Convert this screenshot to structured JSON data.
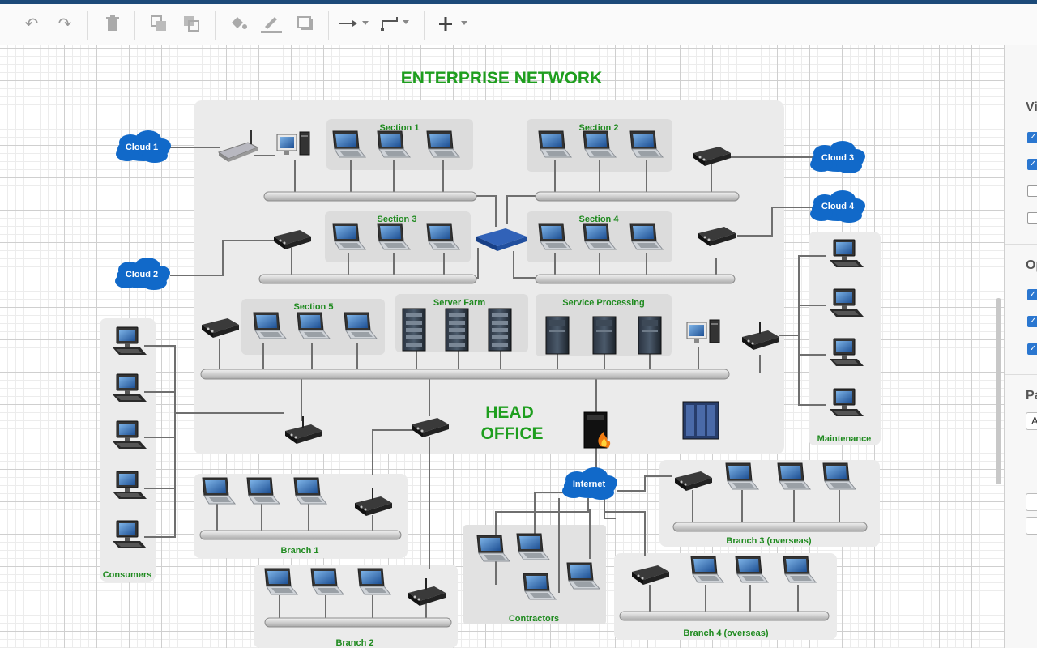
{
  "toolbar": {
    "items": [
      "undo-icon",
      "redo-icon",
      "delete-icon",
      "to-front-icon",
      "to-back-icon",
      "fill-color-icon",
      "line-color-icon",
      "shadow-icon",
      "connection-arrow-icon",
      "waypoints-icon",
      "insert-icon"
    ]
  },
  "diagram": {
    "title": "ENTERPRISE NETWORK",
    "head_office": [
      "HEAD",
      "OFFICE"
    ],
    "clouds": {
      "c1": "Cloud 1",
      "c2": "Cloud 2",
      "c3": "Cloud 3",
      "c4": "Cloud 4",
      "internet": "Internet"
    },
    "sections": {
      "s1": "Section 1",
      "s2": "Section 2",
      "s3": "Section 3",
      "s4": "Section 4",
      "s5": "Section 5",
      "server_farm": "Server Farm",
      "service_processing": "Service Processing"
    },
    "groups": {
      "maintenance": "Maintenance",
      "consumers": "Consumers",
      "branch1": "Branch 1",
      "branch2": "Branch 2",
      "contractors": "Contractors",
      "branch3": "Branch 3 (overseas)",
      "branch4": "Branch 4 (overseas)"
    },
    "colors": {
      "label_green": "#1f8a1f",
      "title_green": "#1e9e1e",
      "cloud_blue": "#1169c9",
      "group_fill": "#ebebeb",
      "section_fill": "#dcdcdc",
      "bus": "#d8d8d8"
    }
  },
  "panel": {
    "heading1": "Vi",
    "heading2": "Op",
    "heading3": "Pa",
    "select_value": "A",
    "checks1": [
      true,
      true,
      false,
      false
    ],
    "checks2": [
      true,
      true,
      true
    ]
  }
}
